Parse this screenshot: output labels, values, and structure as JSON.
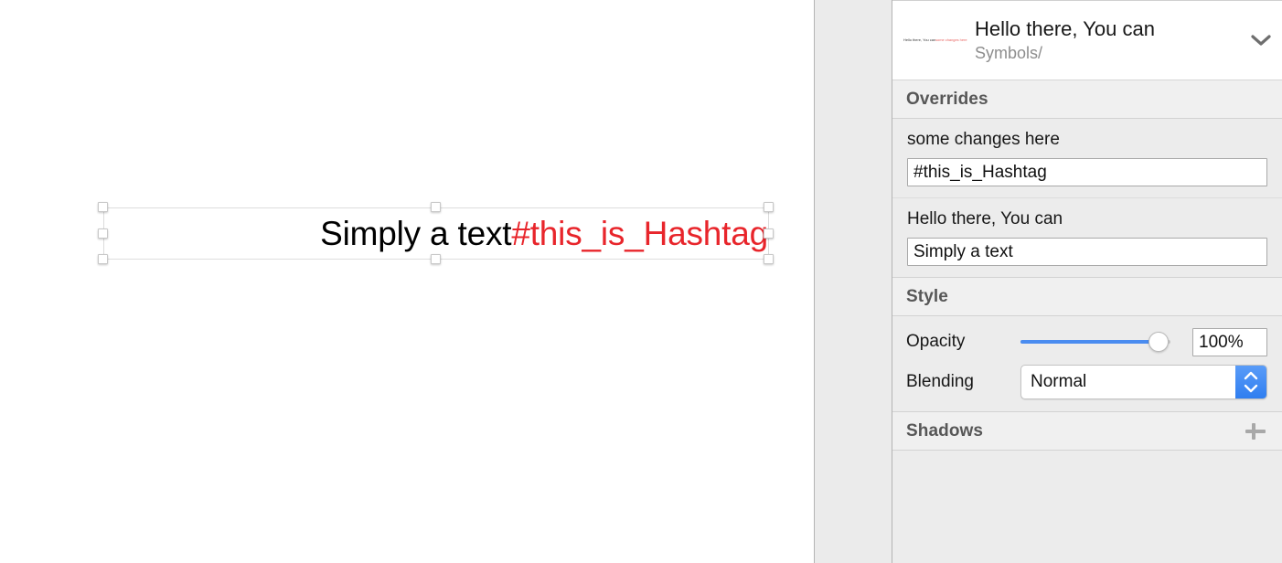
{
  "canvas": {
    "layer": {
      "text_black": "Simply a text",
      "text_red": "#this_is_Hashtag",
      "red_color": "#e8252b"
    }
  },
  "inspector": {
    "symbol": {
      "name": "Hello there, You can",
      "path": "Symbols/",
      "thumbnail_text_black": "Hello there, You can",
      "thumbnail_text_red": "some changes here",
      "chevron_icon": "chevron-down-icon"
    },
    "overrides": {
      "header": "Overrides",
      "items": [
        {
          "label": "some changes here",
          "value": "#this_is_Hashtag"
        },
        {
          "label": "Hello there, You can",
          "value": "Simply a text"
        }
      ]
    },
    "style": {
      "header": "Style",
      "opacity": {
        "label": "Opacity",
        "value": "100%",
        "percent": 100,
        "accent_color": "#4a8cf0"
      },
      "blending": {
        "label": "Blending",
        "value": "Normal",
        "stepper_icon": "stepper-up-down-icon"
      }
    },
    "shadows": {
      "header": "Shadows",
      "add_icon": "plus-icon"
    }
  }
}
